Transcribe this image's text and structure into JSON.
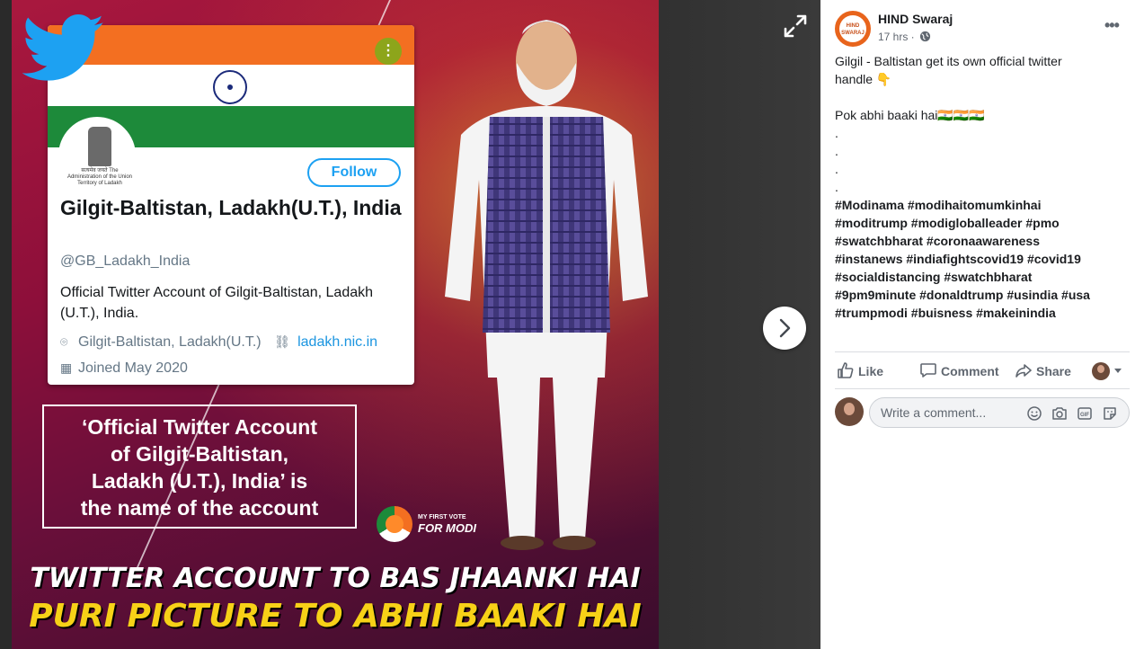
{
  "viewer": {
    "image": {
      "card": {
        "follow_label": "Follow",
        "account_name": "Gilgit-Baltistan, Ladakh(U.T.), India",
        "handle": "@GB_Ladakh_India",
        "bio": "Official Twitter Account of Gilgit-Baltistan, Ladakh (U.T.), India.",
        "location": "Gilgit-Baltistan, Ladakh(U.T.)",
        "link": "ladakh.nic.in",
        "joined": "Joined May 2020",
        "emblem_caption": "सत्यमेव जयते The Administration of the Union Territory of Ladakh"
      },
      "quote_lines": [
        "‘Official Twitter Account",
        "of Gilgit-Baltistan,",
        "Ladakh (U.T.), India’ is",
        "the name of the account"
      ],
      "vote_logo_small": "MY FIRST VOTE",
      "vote_logo_big": "FOR MODI",
      "headline_1": "TWITTER ACCOUNT TO BAS JHAANKI HAI",
      "headline_2": "PURI PICTURE TO ABHI BAAKI HAI"
    }
  },
  "post": {
    "page_name": "HIND Swaraj",
    "avatar_text": "HIND SWARAJ",
    "time": "17 hrs ·",
    "text_lines": [
      "Gilgil - Baltistan get its own official twitter",
      "handle 👇",
      "",
      "Pok abhi baaki hai🇮🇳🇮🇳🇮🇳",
      ".",
      ".",
      ".",
      "."
    ],
    "hashtags": [
      "#Modinama #modihaitomumkinhai",
      "#moditrump #modigloballeader #pmo",
      "#swatchbharat #coronaawareness",
      "#instanews #indiafightscovid19 #covid19",
      "#socialdistancing #swatchbharat",
      "#9pm9minute #donaldtrump #usindia #usa",
      "#trumpmodi #buisness #makeinindia"
    ]
  },
  "actions": {
    "like": "Like",
    "comment": "Comment",
    "share": "Share"
  },
  "comment_box": {
    "placeholder": "Write a comment..."
  },
  "colors": {
    "accent": "#1da1f2",
    "link": "#1b95e0",
    "saffron": "#f36f21",
    "green": "#1d8a3a",
    "headline_yellow": "#f7d117"
  }
}
